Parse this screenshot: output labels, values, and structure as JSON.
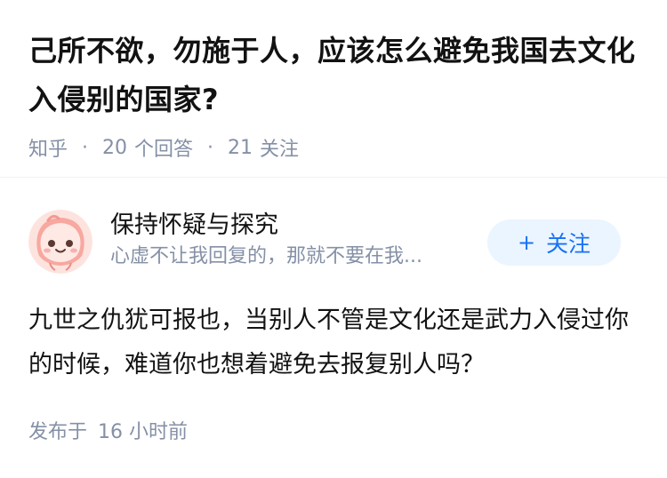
{
  "question": {
    "title": "己所不欲，勿施于人，应该怎么避免我国去文化入侵别的国家?",
    "source": "知乎",
    "answer_count": "20",
    "answer_label": "个回答",
    "follower_count": "21",
    "follower_label": "关注",
    "separator": "·"
  },
  "author": {
    "name": "保持怀疑与探究",
    "bio": "心虚不让我回复的，那就不要在我...",
    "avatar_icon": "cartoon-avatar"
  },
  "follow_button": {
    "plus": "+",
    "label": "关注"
  },
  "answer": {
    "content": "九世之仇犹可报也，当别人不管是文化还是武力入侵过你的时候，难道你也想着避免去报复别人吗？"
  },
  "publish": {
    "label": "发布于",
    "time": "16 小时前"
  },
  "colors": {
    "accent": "#1772f6",
    "accent_bg": "#ebf5ff",
    "meta_text": "#8590a6",
    "primary_text": "#121212",
    "avatar_bg": "#fde3de"
  }
}
